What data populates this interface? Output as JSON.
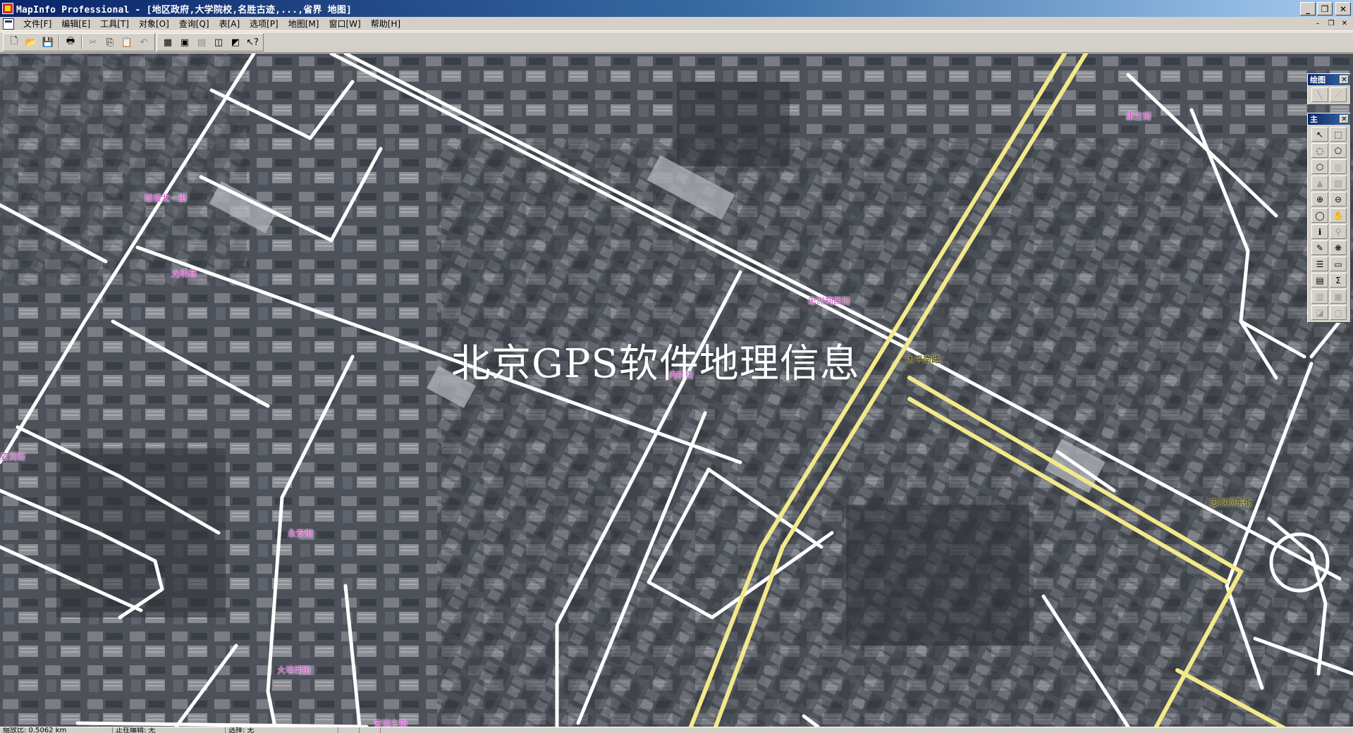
{
  "window": {
    "title": "MapInfo Professional - [地区政府,大学院校,名胜古迹,...,省界 地图]",
    "min_glyph": "_",
    "max_glyph": "❐",
    "close_glyph": "✕"
  },
  "menubar": {
    "items": [
      "文件[F]",
      "编辑[E]",
      "工具[T]",
      "对象[O]",
      "查询[Q]",
      "表[A]",
      "选项[P]",
      "地图[M]",
      "窗口[W]",
      "帮助[H]"
    ],
    "mdi_min": "–",
    "mdi_restore": "❐",
    "mdi_close": "✕"
  },
  "toolbar": {
    "file_group": [
      {
        "name": "new-icon",
        "glyph": "🗋"
      },
      {
        "name": "open-icon",
        "glyph": "📂"
      },
      {
        "name": "save-icon",
        "glyph": "💾",
        "dim": true
      },
      {
        "name": "print-icon",
        "glyph": "🖶"
      },
      {
        "name": "cut-icon",
        "glyph": "✂",
        "dim": true
      },
      {
        "name": "copy-icon",
        "glyph": "⎘"
      },
      {
        "name": "paste-icon",
        "glyph": "📋",
        "dim": true
      },
      {
        "name": "undo-icon",
        "glyph": "↶",
        "dim": true
      }
    ],
    "window_group": [
      {
        "name": "new-browser-icon",
        "glyph": "▦"
      },
      {
        "name": "new-mapper-icon",
        "glyph": "▣"
      },
      {
        "name": "new-grapher-icon",
        "glyph": "▤",
        "dim": true
      },
      {
        "name": "new-layout-icon",
        "glyph": "◫"
      },
      {
        "name": "redistrict-icon",
        "glyph": "◩"
      },
      {
        "name": "help-pointer-icon",
        "glyph": "↖?"
      }
    ]
  },
  "map": {
    "labels": [
      {
        "text": "鼓楼北一街",
        "kind": "street"
      },
      {
        "text": "光明巷",
        "kind": "street"
      },
      {
        "text": "忠烈祠西街",
        "kind": "street"
      },
      {
        "text": "太平南路",
        "kind": "yellow-road"
      },
      {
        "text": "康庄街",
        "kind": "street"
      },
      {
        "text": "内桥街",
        "kind": "street"
      },
      {
        "text": "忠烈祠东街",
        "kind": "yellow-road"
      },
      {
        "text": "永安街",
        "kind": "street"
      },
      {
        "text": "大墙西街",
        "kind": "street"
      },
      {
        "text": "安瑞东街",
        "kind": "street"
      },
      {
        "text": "姿润街",
        "kind": "street"
      }
    ],
    "watermark": "北京GPS软件地理信息",
    "colors": {
      "street": "#ffffff",
      "main_road": "#f0e68c",
      "label": "#c63fc0"
    }
  },
  "palettes": {
    "drawing": {
      "title": "绘图",
      "tools": [
        {
          "name": "line-tool-icon",
          "glyph": "╲",
          "dim": true
        },
        {
          "name": "polyline-tool-icon",
          "glyph": "⟋",
          "dim": true
        }
      ]
    },
    "main": {
      "title": "主",
      "tools": [
        {
          "name": "select-icon",
          "glyph": "↖"
        },
        {
          "name": "marquee-select-icon",
          "glyph": "⬚"
        },
        {
          "name": "radius-select-icon",
          "glyph": "◌"
        },
        {
          "name": "polygon-select-icon",
          "glyph": "⬠"
        },
        {
          "name": "boundary-select-icon",
          "glyph": "⬡"
        },
        {
          "name": "unselect-all-icon",
          "glyph": "◎",
          "dim": true
        },
        {
          "name": "graph-select-icon",
          "glyph": "▲",
          "dim": true
        },
        {
          "name": "invert-selection-icon",
          "glyph": "▧",
          "dim": true
        },
        {
          "name": "zoom-in-icon",
          "glyph": "⊕"
        },
        {
          "name": "zoom-out-icon",
          "glyph": "⊖"
        },
        {
          "name": "change-view-icon",
          "glyph": "◯"
        },
        {
          "name": "grabber-hand-icon",
          "glyph": "✋"
        },
        {
          "name": "info-icon",
          "glyph": "ℹ"
        },
        {
          "name": "hotlink-icon",
          "glyph": "⚲",
          "dim": true
        },
        {
          "name": "label-icon",
          "glyph": "✎"
        },
        {
          "name": "drag-window-icon",
          "glyph": "❋"
        },
        {
          "name": "layer-control-icon",
          "glyph": "☰"
        },
        {
          "name": "ruler-icon",
          "glyph": "▭"
        },
        {
          "name": "legend-icon",
          "glyph": "▤"
        },
        {
          "name": "statistics-icon",
          "glyph": "Σ"
        },
        {
          "name": "clip-region-icon",
          "glyph": "▥",
          "dim": true
        },
        {
          "name": "set-clip-icon",
          "glyph": "▦",
          "dim": true
        },
        {
          "name": "show-all-icon",
          "glyph": "◪",
          "dim": true
        },
        {
          "name": "layout-icon",
          "glyph": "▢",
          "dim": true
        }
      ]
    }
  },
  "statusbar": {
    "zoom": "缩放比: 0.5062 km",
    "editing": "正在编辑: 无",
    "selected": "选择: 无"
  }
}
